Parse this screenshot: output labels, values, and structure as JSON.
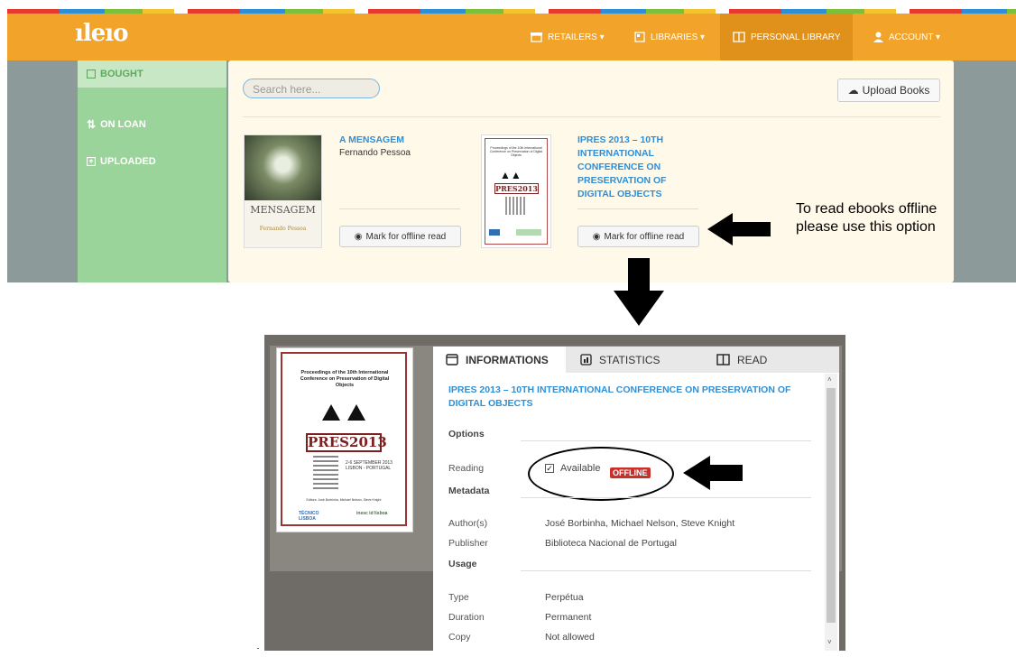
{
  "top": {
    "logo": "ıleıo",
    "nav": {
      "retailers": "RETAILERS ▾",
      "libraries": "LIBRARIES ▾",
      "personal_library": "PERSONAL LIBRARY",
      "account": "ACCOUNT ▾"
    },
    "sidebar": [
      "BOUGHT",
      "ON LOAN",
      "UPLOADED"
    ],
    "search_placeholder": "Search here...",
    "upload_label": "Upload Books",
    "books": [
      {
        "title": "A MENSAGEM",
        "author": "Fernando Pessoa",
        "mark_label": "Mark for offline read",
        "cover_title": "MENSAGEM",
        "cover_author": "Fernando Pessoa"
      },
      {
        "title": "IPRES 2013 – 10TH INTERNATIONAL CONFERENCE ON PRESERVATION OF DIGITAL OBJECTS",
        "mark_label": "Mark for offline read"
      }
    ],
    "annotation": "To read ebooks offline please use this option"
  },
  "cover_ipres": {
    "heading": "Proceedings of the 10th International Conference on Preservation of Digital Objects",
    "logo_text": "PRES2013",
    "date": "2-6 SEPTEMBER 2013 LISBON - PORTUGAL",
    "editors": "Editors: José Borbinha, Michael Nelson, Steve Knight",
    "partner1": "TÉCNICO LISBOA",
    "partner2": "inesc id lisboa"
  },
  "detail": {
    "tabs": [
      "INFORMATIONS",
      "STATISTICS",
      "READ"
    ],
    "title": "IPRES 2013 – 10TH INTERNATIONAL CONFERENCE ON PRESERVATION OF DIGITAL OBJECTS",
    "options_heading": "Options",
    "reading_label": "Reading",
    "reading_value": "Available",
    "offline_badge": "OFFLINE",
    "metadata_heading": "Metadata",
    "author_label": "Author(s)",
    "author_value": "José Borbinha, Michael Nelson, Steve Knight",
    "publisher_label": "Publisher",
    "publisher_value": "Biblioteca Nacional de Portugal",
    "usage_heading": "Usage",
    "type_label": "Type",
    "type_value": "Perpétua",
    "duration_label": "Duration",
    "duration_value": "Permanent",
    "copy_label": "Copy",
    "copy_value": "Not allowed"
  },
  "colors": {
    "orange": "#f2a32a",
    "sidebar_green": "#9bd49b",
    "link_blue": "#2f8fd6",
    "badge_red": "#c9302c"
  }
}
